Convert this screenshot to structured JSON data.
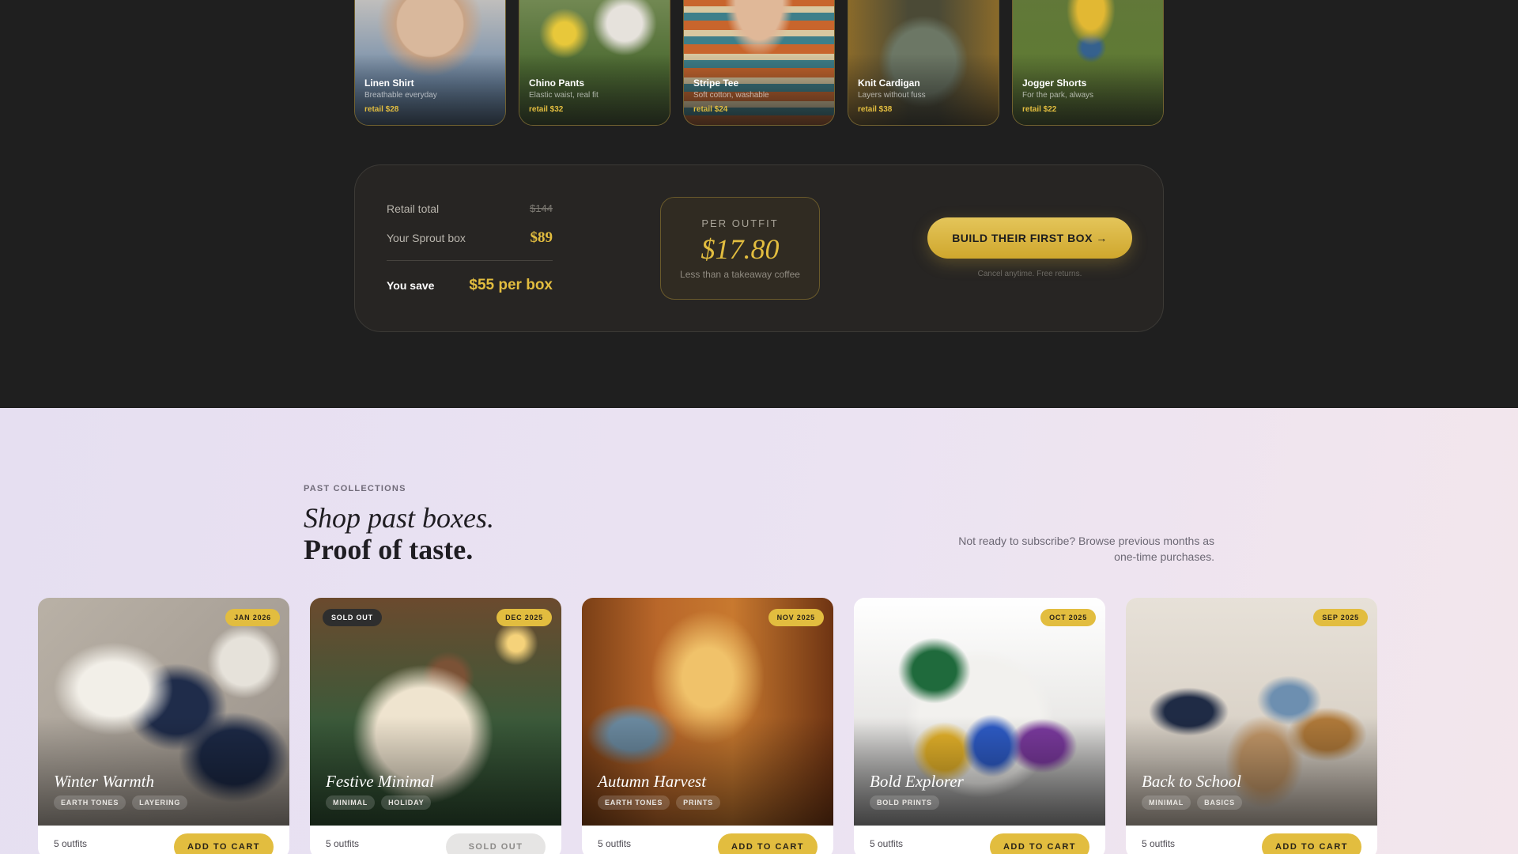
{
  "outfits": [
    {
      "name": "Linen Shirt",
      "desc": "Breathable everyday",
      "price": "retail $28"
    },
    {
      "name": "Chino Pants",
      "desc": "Elastic waist, real fit",
      "price": "retail $32"
    },
    {
      "name": "Stripe Tee",
      "desc": "Soft cotton, washable",
      "price": "retail $24"
    },
    {
      "name": "Knit Cardigan",
      "desc": "Layers without fuss",
      "price": "retail $38"
    },
    {
      "name": "Jogger Shorts",
      "desc": "For the park, always",
      "price": "retail $22"
    }
  ],
  "pricing": {
    "retail_label": "Retail total",
    "retail_value": "$144",
    "box_label": "Your Sprout box",
    "box_value": "$89",
    "save_label": "You save",
    "save_value": "$55 per box",
    "per_outfit_label": "PER OUTFIT",
    "per_outfit_value": "$17.80",
    "per_outfit_sub": "Less than a takeaway coffee",
    "cta": "BUILD THEIR FIRST BOX →",
    "cta_note": "Cancel anytime. Free returns."
  },
  "past": {
    "eyebrow": "PAST COLLECTIONS",
    "headline_1": "Shop past boxes.",
    "headline_2": "Proof of taste.",
    "note": "Not ready to subscribe? Browse previous months as one-time purchases."
  },
  "collections": [
    {
      "title": "Winter Warmth",
      "date": "JAN 2026",
      "tags": [
        "EARTH TONES",
        "LAYERING"
      ],
      "count": "5 outfits",
      "button": "ADD TO CART",
      "sold_out": false
    },
    {
      "title": "Festive Minimal",
      "date": "DEC 2025",
      "tags": [
        "MINIMAL",
        "HOLIDAY"
      ],
      "count": "5 outfits",
      "button": "SOLD OUT",
      "sold_out": true,
      "sold_label": "SOLD OUT"
    },
    {
      "title": "Autumn Harvest",
      "date": "NOV 2025",
      "tags": [
        "EARTH TONES",
        "PRINTS"
      ],
      "count": "5 outfits",
      "button": "ADD TO CART",
      "sold_out": false
    },
    {
      "title": "Bold Explorer",
      "date": "OCT 2025",
      "tags": [
        "BOLD PRINTS"
      ],
      "count": "5 outfits",
      "button": "ADD TO CART",
      "sold_out": false
    },
    {
      "title": "Back to School",
      "date": "SEP 2025",
      "tags": [
        "MINIMAL",
        "BASICS"
      ],
      "count": "5 outfits",
      "button": "ADD TO CART",
      "sold_out": false
    }
  ],
  "colors": {
    "gold": "#e2bd3f",
    "dark_bg": "#1f1f1f",
    "light_bg": "#e6dff1"
  }
}
